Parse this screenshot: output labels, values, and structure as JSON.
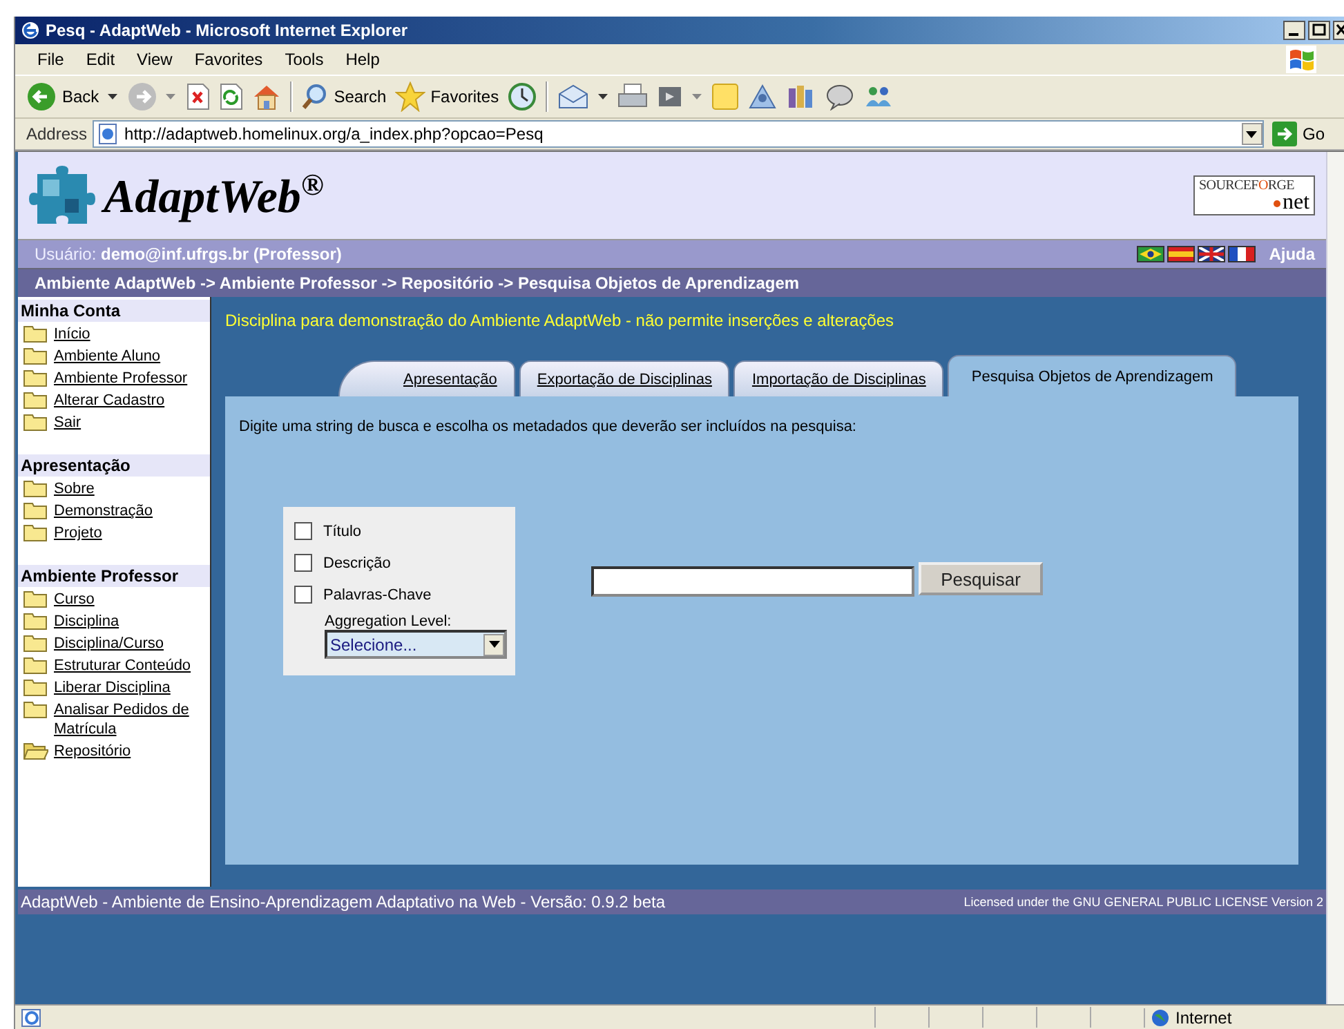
{
  "window": {
    "title": "Pesq - AdaptWeb - Microsoft Internet Explorer"
  },
  "menu": [
    {
      "label": "File"
    },
    {
      "label": "Edit"
    },
    {
      "label": "View"
    },
    {
      "label": "Favorites"
    },
    {
      "label": "Tools"
    },
    {
      "label": "Help"
    }
  ],
  "toolbar": {
    "back": "Back",
    "search": "Search",
    "favorites": "Favorites"
  },
  "address_bar": {
    "label": "Address",
    "value": "http://adaptweb.homelinux.org/a_index.php?opcao=Pesq",
    "go": "Go"
  },
  "header": {
    "logo": "AdaptWeb$^{®}$",
    "sourceforge": [
      "SOURCEF",
      "O",
      "RGE",
      "net"
    ]
  },
  "user_bar": {
    "label": "Usuário:",
    "user": "demo@inf.ufrgs.br (Professor)",
    "help": "Ajuda"
  },
  "breadcrumb": "Ambiente AdaptWeb -> Ambiente Professor -> Repositório -> Pesquisa Objetos de Aprendizagem",
  "sidebar": {
    "sections": [
      {
        "title": "Minha Conta",
        "items": [
          {
            "label": "Início",
            "selected": false
          },
          {
            "label": "Ambiente Aluno",
            "selected": false
          },
          {
            "label": "Ambiente Professor",
            "selected": false
          },
          {
            "label": "Alterar Cadastro",
            "selected": false
          },
          {
            "label": "Sair",
            "selected": false
          }
        ]
      },
      {
        "title": "Apresentação",
        "items": [
          {
            "label": "Sobre",
            "selected": false
          },
          {
            "label": "Demonstração",
            "selected": false
          },
          {
            "label": "Projeto",
            "selected": false
          }
        ]
      },
      {
        "title": "Ambiente Professor",
        "items": [
          {
            "label": "Curso",
            "selected": false
          },
          {
            "label": "Disciplina",
            "selected": false
          },
          {
            "label": "Disciplina/Curso",
            "selected": false
          },
          {
            "label": "Estruturar Conteúdo",
            "selected": false
          },
          {
            "label": "Liberar Disciplina",
            "selected": false
          },
          {
            "label": "Analisar Pedidos de Matrícula",
            "selected": false
          },
          {
            "label": "Repositório",
            "selected": true
          }
        ]
      }
    ]
  },
  "notice": "Disciplina para demonstração do Ambiente AdaptWeb - não permite inserções e alterações",
  "tabs": [
    {
      "label": "Apresentação",
      "selected": false
    },
    {
      "label": "Exportação de Disciplinas",
      "selected": false
    },
    {
      "label": "Importação de Disciplinas",
      "selected": false
    },
    {
      "label": "Pesquisa Objetos de Aprendizagem",
      "selected": true
    }
  ],
  "instruction": "Digite uma string de busca e escolha os metadados que deverão ser incluídos na pesquisa:",
  "filters": [
    {
      "label": "Título",
      "checked": false
    },
    {
      "label": "Descrição",
      "checked": false
    },
    {
      "label": "Palavras-Chave",
      "checked": false
    }
  ],
  "aggregation": {
    "label": "Aggregation Level:",
    "value": "Selecione..."
  },
  "search_button": "Pesquisar",
  "footer": {
    "left": "AdaptWeb - Ambiente de Ensino-Aprendizagem Adaptativo na Web - Versão: 0.9.2 beta",
    "right": "Licensed under the GNU GENERAL PUBLIC LICENSE Version 2"
  },
  "status_bar": {
    "zone": "Internet"
  }
}
